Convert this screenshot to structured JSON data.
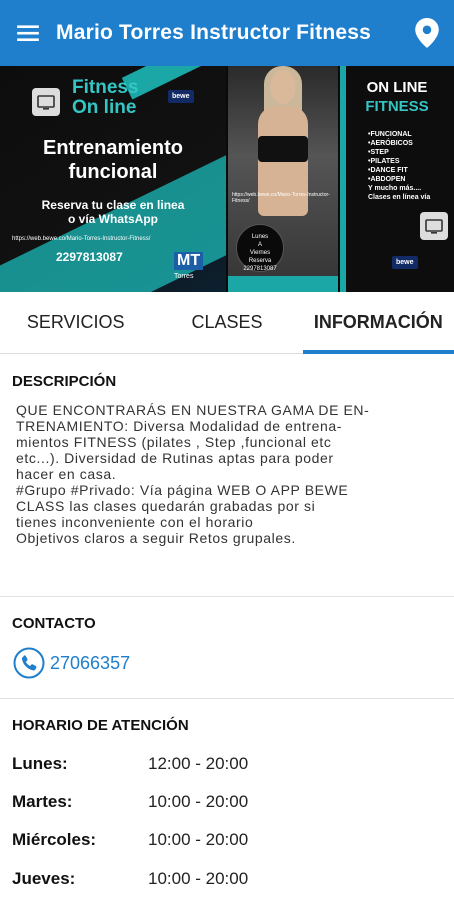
{
  "appbar": {
    "title": "Mario Torres Instructor Fitness",
    "menu_icon": "menu-icon",
    "location_icon": "location-pin-icon",
    "color": "#1f7fcc"
  },
  "banner": {
    "p1_fitness": "Fitness",
    "p1_online": "On line",
    "p1_bewe": "bewe",
    "p1_title_1": "Entrenamiento",
    "p1_title_2": "funcional",
    "p1_reserva_1": "Reserva tu clase en linea",
    "p1_reserva_2": "o vía WhatsApp",
    "p1_url": "https://web.bewe.co/Mario-Torres-Instructor-Fitness/",
    "p1_phone": "2297813087",
    "p1_mt": "MT",
    "p1_torres": "Torres",
    "p2_url": "https://web.bewe.co/Mario-Torres-Instructor-Fitness/",
    "p2_circle_1": "Lunes",
    "p2_circle_2": "A",
    "p2_circle_3": "Viernes",
    "p2_circle_4": "Reserva",
    "p2_circle_5": "2297813087",
    "p3_online": "ON LINE",
    "p3_fitness": "FITNESS",
    "p3_list": [
      "•FUNCIONAL",
      "•AERÓBICOS",
      "•STEP",
      "•PILATES",
      "•DANCE FIT",
      "•ABDOPEN",
      "Y mucho más....",
      "Clases en línea vía"
    ]
  },
  "tabs": [
    {
      "label": "SERVICIOS",
      "active": false
    },
    {
      "label": "CLASES",
      "active": false
    },
    {
      "label": "INFORMACIÓN",
      "active": true
    }
  ],
  "description": {
    "title": "DESCRIPCIÓN",
    "lines": [
      "QUE ENCONTRARÁS EN NUESTRA GAMA DE EN-",
      "TRENAMIENTO: Diversa Modalidad de entrena-",
      "mientos FITNESS (pilates , Step ,funcional etc",
      "etc...). Diversidad de Rutinas aptas para poder",
      "hacer en casa.",
      "#Grupo #Privado: Vía página WEB O APP BEWE",
      "CLASS las clases quedarán grabadas por si",
      "tienes inconveniente con el horario",
      "Objetivos claros a seguir Retos grupales."
    ]
  },
  "contact": {
    "title": "CONTACTO",
    "phone": "27066357",
    "icon": "phone-icon"
  },
  "schedule": {
    "title": "HORARIO DE ATENCIÓN",
    "rows": [
      {
        "day": "Lunes:",
        "hours": "12:00 - 20:00"
      },
      {
        "day": "Martes:",
        "hours": "10:00 - 20:00"
      },
      {
        "day": "Miércoles:",
        "hours": "10:00 - 20:00"
      },
      {
        "day": "Jueves:",
        "hours": "10:00 - 20:00"
      }
    ]
  }
}
